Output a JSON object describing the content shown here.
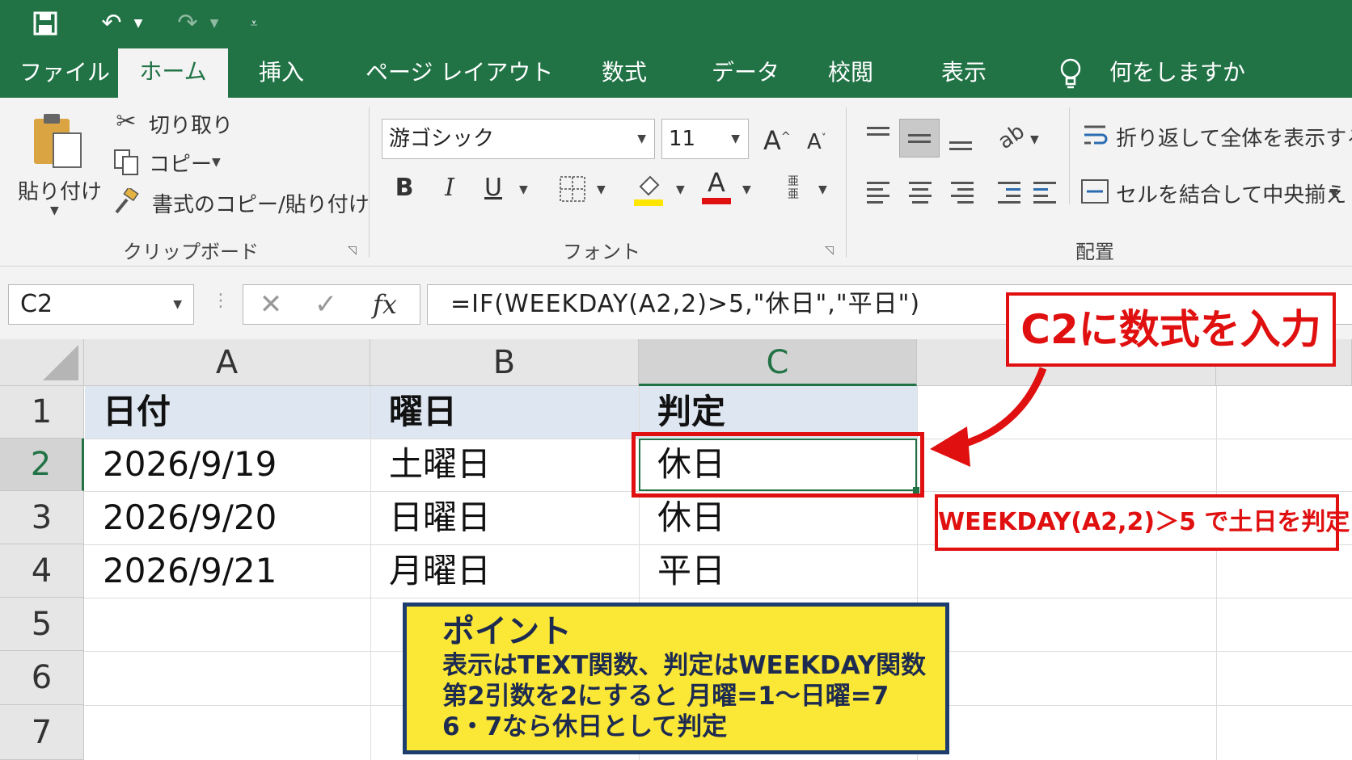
{
  "qat": {
    "save_icon": "save-icon",
    "undo_icon": "undo-icon",
    "redo_icon": "redo-icon",
    "customize_icon": "customize-qat-icon"
  },
  "tabs": [
    {
      "label": "ファイル"
    },
    {
      "label": "ホーム"
    },
    {
      "label": "挿入"
    },
    {
      "label": "ページ レイアウト"
    },
    {
      "label": "数式"
    },
    {
      "label": "データ"
    },
    {
      "label": "校閲"
    },
    {
      "label": "表示"
    }
  ],
  "tell_me": "何をしますか",
  "ribbon": {
    "clipboard": {
      "paste": "貼り付け",
      "cut": "切り取り",
      "copy": "コピー",
      "format_painter": "書式のコピー/貼り付け",
      "label": "クリップボード"
    },
    "font": {
      "font_name": "游ゴシック",
      "font_size": "11",
      "grow": "A",
      "shrink": "A",
      "bold": "B",
      "italic": "I",
      "underline": "U",
      "font_color_letter": "A",
      "label": "フォント"
    },
    "alignment": {
      "wrap_text": "折り返して全体を表示する",
      "merge_center": "セルを結合して中央揃え",
      "label": "配置"
    }
  },
  "formula_bar": {
    "name_box": "C2",
    "fx": "fx",
    "formula": "=IF(WEEKDAY(A2,2)>5,\"休日\",\"平日\")"
  },
  "sheet": {
    "columns": [
      "A",
      "B",
      "C"
    ],
    "rows": [
      "1",
      "2",
      "3",
      "4",
      "5",
      "6",
      "7"
    ],
    "cells": [
      [
        "日付",
        "曜日",
        "判定"
      ],
      [
        "2026/9/19",
        "土曜日",
        "休日"
      ],
      [
        "2026/9/20",
        "日曜日",
        "休日"
      ],
      [
        "2026/9/21",
        "月曜日",
        "平日"
      ]
    ]
  },
  "callouts": {
    "main": "C2に数式を入力",
    "sub": "WEEKDAY(A2,2)＞5 で土日を判定",
    "point_title": "ポイント",
    "point_lines": [
      "表示はTEXT関数、判定はWEEKDAY関数",
      "第2引数を2にすると 月曜=1～日曜=7",
      "6・7なら休日として判定"
    ]
  },
  "colors": {
    "excel_green": "#217346",
    "callout_red": "#e01010",
    "point_yellow": "#fbe736",
    "point_border": "#1d3d6e"
  }
}
